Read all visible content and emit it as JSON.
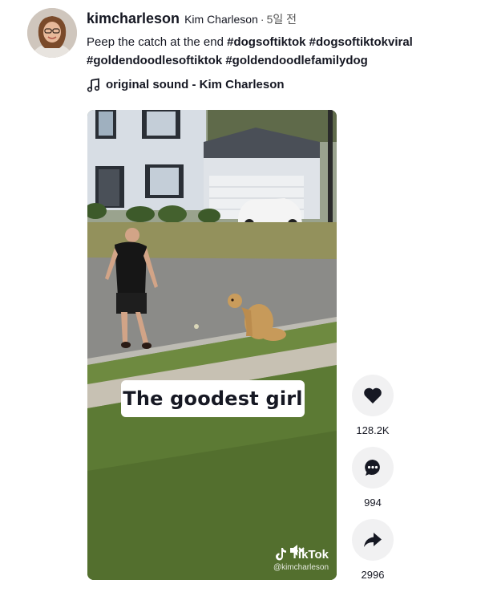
{
  "post": {
    "username": "kimcharleson",
    "display_name": "Kim Charleson",
    "separator": "·",
    "time_ago": "5일 전",
    "caption_text": "Peep the catch at the end",
    "hashtags": [
      "#dogsoftiktok",
      "#dogsoftiktokviral",
      "#goldendoodlesoftiktok",
      "#goldendoodlefamilydog"
    ],
    "sound": "original sound - Kim Charleson",
    "sound_icon": "music-note-icon"
  },
  "video": {
    "overlay_caption": "The goodest girl",
    "watermark_logo": "TikTok",
    "watermark_handle": "@kimcharleson"
  },
  "actions": {
    "like_count": "128.2K",
    "comment_count": "994",
    "share_count": "2996",
    "like_icon": "heart-icon",
    "comment_icon": "comment-icon",
    "share_icon": "share-icon"
  }
}
